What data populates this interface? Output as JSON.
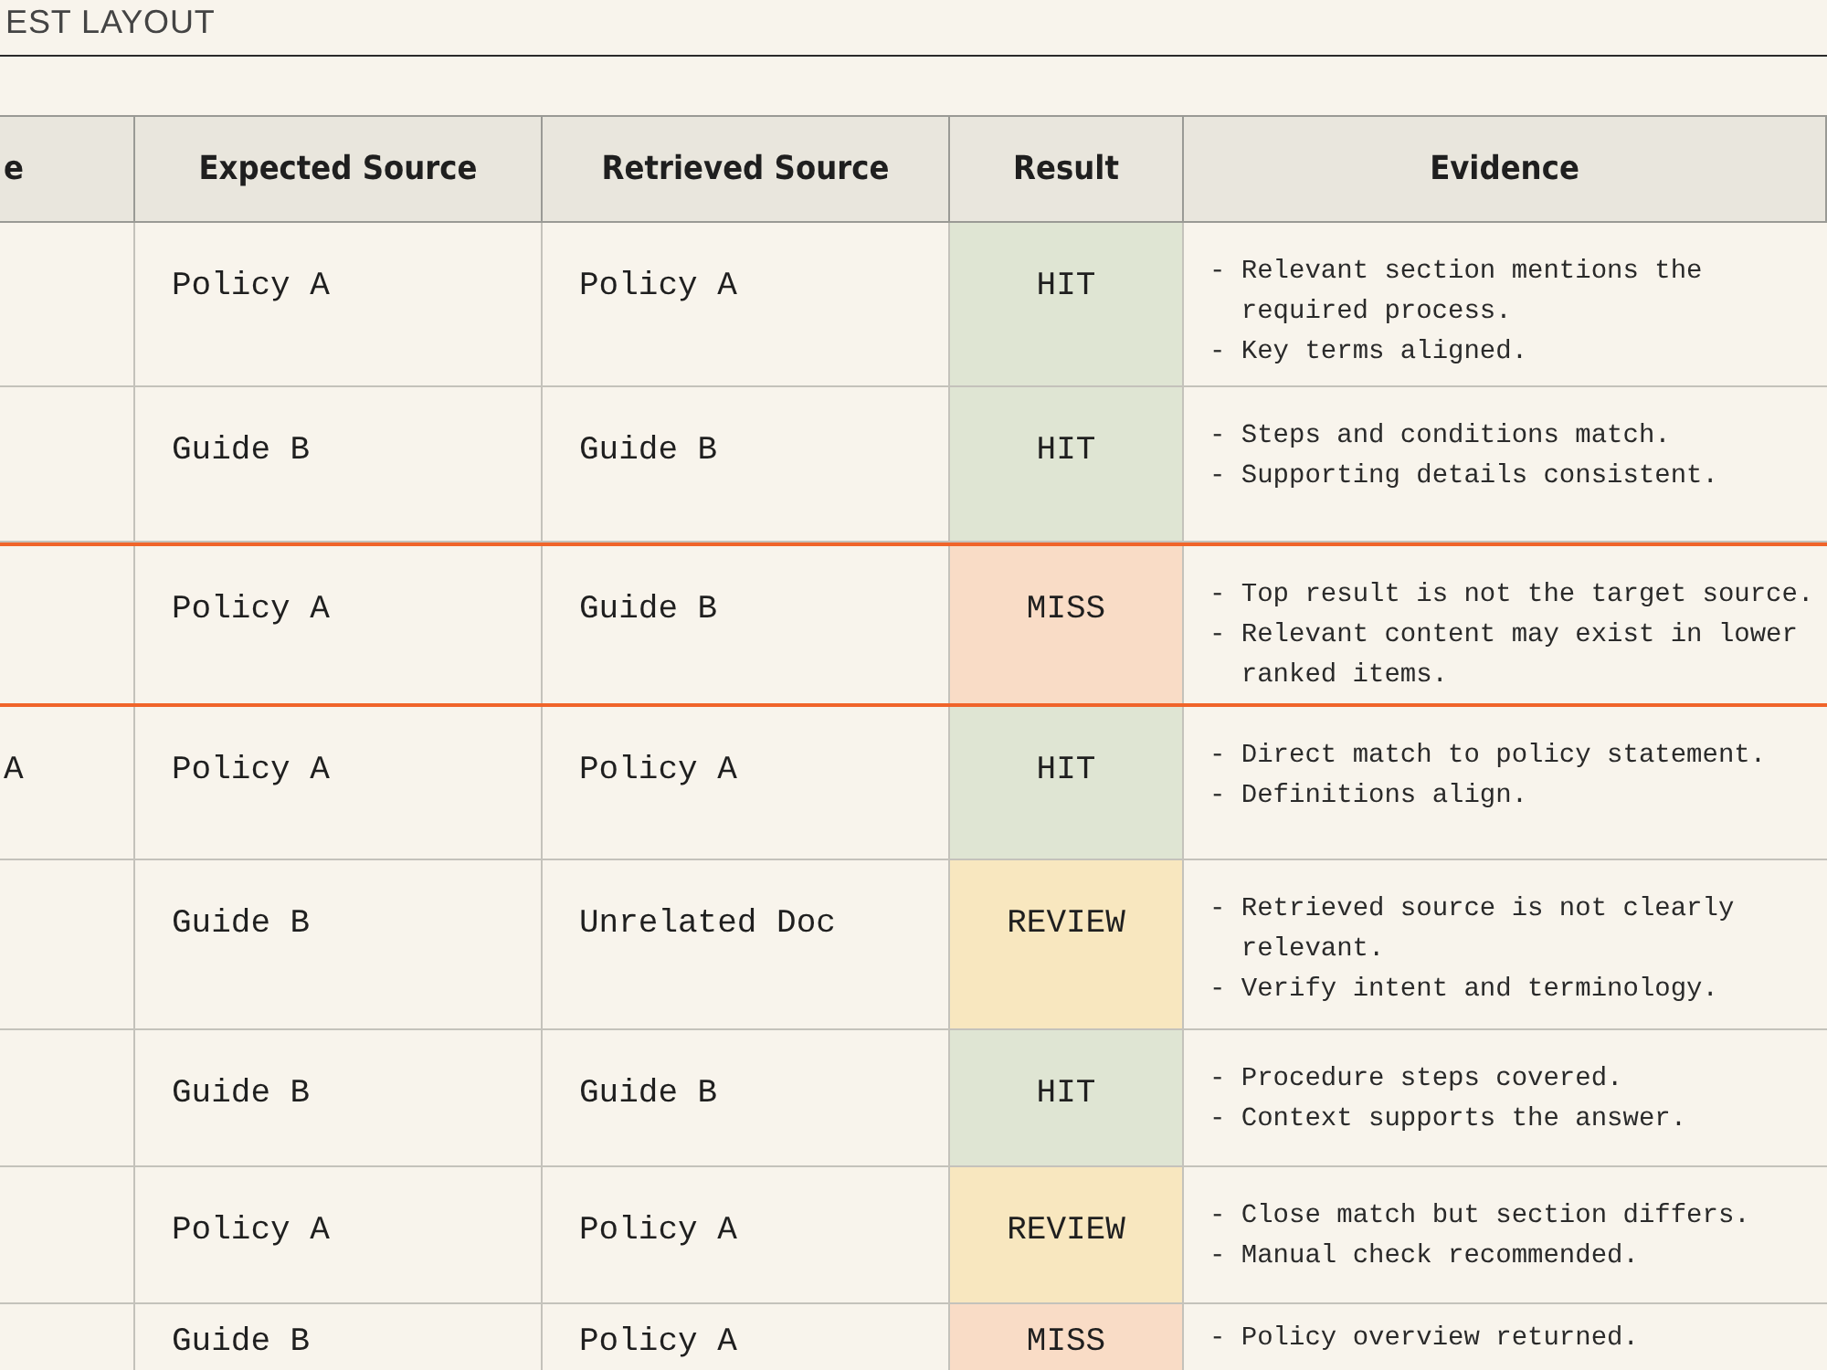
{
  "title": "EST LAYOUT",
  "table": {
    "columns": [
      "e",
      "Expected Source",
      "Retrieved Source",
      "Result",
      "Evidence"
    ],
    "rows": [
      {
        "highlighted": false,
        "expected": "Policy A",
        "retrieved": "Policy A",
        "result": {
          "kind": "hit",
          "text": "HIT"
        },
        "evidence": [
          "- Relevant section mentions the required process.",
          "- Key terms aligned."
        ]
      },
      {
        "highlighted": false,
        "expected": "Guide B",
        "retrieved": "Guide B",
        "result": {
          "kind": "hit",
          "text": "HIT"
        },
        "evidence": [
          "- Steps and conditions match.",
          "- Supporting details consistent."
        ]
      },
      {
        "highlighted": true,
        "expected": "Policy A",
        "retrieved": "Guide B",
        "result": {
          "kind": "miss",
          "text": "MISS"
        },
        "evidence": [
          "- Top result is not the target source.",
          "- Relevant content may exist in lower ranked items."
        ]
      },
      {
        "highlighted": false,
        "column_1": "A",
        "expected": "Policy A",
        "retrieved": "Policy A",
        "result": {
          "kind": "hit",
          "text": "HIT"
        },
        "evidence": [
          "- Direct match to policy statement.",
          "- Definitions align."
        ]
      },
      {
        "highlighted": false,
        "expected": "Guide B",
        "retrieved": "Unrelated Doc",
        "result": {
          "kind": "review",
          "text": "REVIEW"
        },
        "evidence": [
          "- Retrieved source is not clearly relevant.",
          "- Verify intent and terminology."
        ]
      },
      {
        "highlighted": false,
        "expected": "Guide B",
        "retrieved": "Guide B",
        "result": {
          "kind": "hit",
          "text": "HIT"
        },
        "evidence": [
          "- Procedure steps covered.",
          "- Context supports the answer."
        ]
      },
      {
        "highlighted": false,
        "expected": "Policy A",
        "retrieved": "Policy A",
        "result": {
          "kind": "review",
          "text": "REVIEW"
        },
        "evidence": [
          "- Close match but section differs.",
          "- Manual check recommended."
        ]
      },
      {
        "highlighted": false,
        "expected": "Guide B",
        "retrieved": "Policy A",
        "result": {
          "kind": "miss",
          "text": "MISS"
        },
        "evidence": [
          "- Policy overview returned."
        ]
      }
    ]
  }
}
